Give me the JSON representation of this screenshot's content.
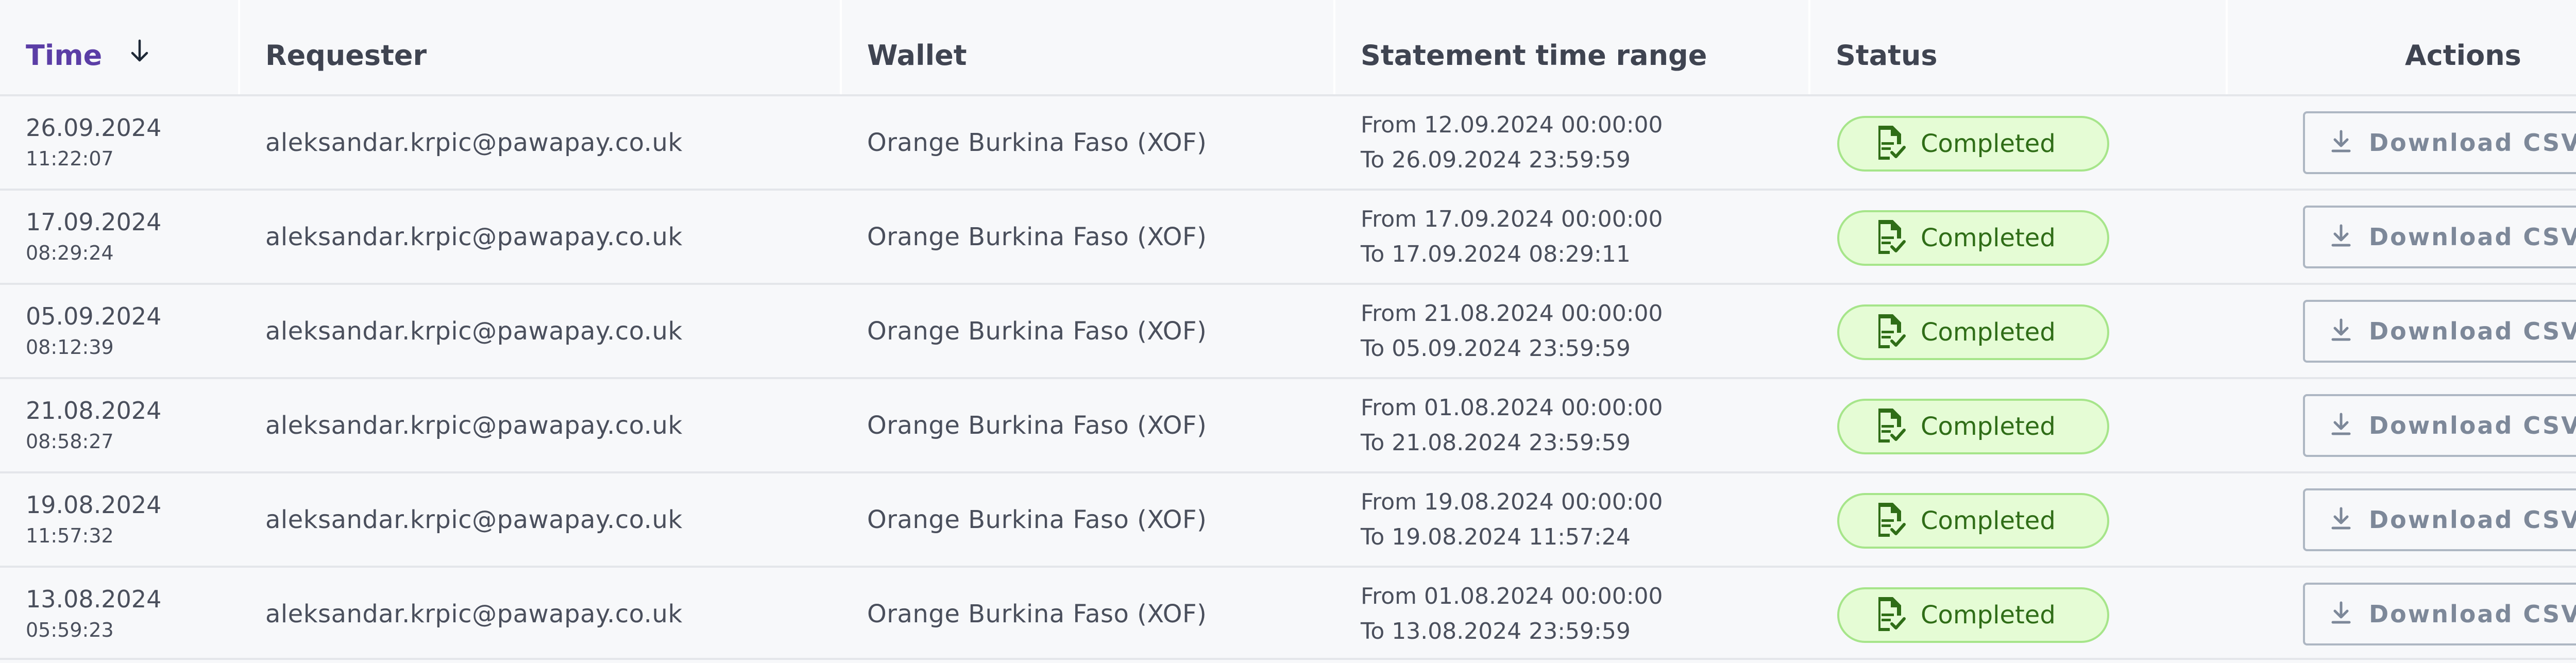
{
  "table": {
    "columns": {
      "time": "Time",
      "requester": "Requester",
      "wallet": "Wallet",
      "range": "Statement time range",
      "status": "Status",
      "actions": "Actions"
    },
    "sort": {
      "column": "time",
      "direction": "descending",
      "icon": "arrow-down-icon"
    },
    "rows": [
      {
        "date": "26.09.2024",
        "time": "11:22:07",
        "requester": "aleksandar.krpic@pawapay.co.uk",
        "wallet": "Orange Burkina Faso (XOF)",
        "range_from": "From 12.09.2024 00:00:00",
        "range_to": "To 26.09.2024 23:59:59",
        "status": "Completed",
        "action": "Download CSV"
      },
      {
        "date": "17.09.2024",
        "time": "08:29:24",
        "requester": "aleksandar.krpic@pawapay.co.uk",
        "wallet": "Orange Burkina Faso (XOF)",
        "range_from": "From 17.09.2024 00:00:00",
        "range_to": "To 17.09.2024 08:29:11",
        "status": "Completed",
        "action": "Download CSV"
      },
      {
        "date": "05.09.2024",
        "time": "08:12:39",
        "requester": "aleksandar.krpic@pawapay.co.uk",
        "wallet": "Orange Burkina Faso (XOF)",
        "range_from": "From 21.08.2024 00:00:00",
        "range_to": "To 05.09.2024 23:59:59",
        "status": "Completed",
        "action": "Download CSV"
      },
      {
        "date": "21.08.2024",
        "time": "08:58:27",
        "requester": "aleksandar.krpic@pawapay.co.uk",
        "wallet": "Orange Burkina Faso (XOF)",
        "range_from": "From 01.08.2024 00:00:00",
        "range_to": "To 21.08.2024 23:59:59",
        "status": "Completed",
        "action": "Download CSV"
      },
      {
        "date": "19.08.2024",
        "time": "11:57:32",
        "requester": "aleksandar.krpic@pawapay.co.uk",
        "wallet": "Orange Burkina Faso (XOF)",
        "range_from": "From 19.08.2024 00:00:00",
        "range_to": "To 19.08.2024 11:57:24",
        "status": "Completed",
        "action": "Download CSV"
      },
      {
        "date": "13.08.2024",
        "time": "05:59:23",
        "requester": "aleksandar.krpic@pawapay.co.uk",
        "wallet": "Orange Burkina Faso (XOF)",
        "range_from": "From 01.08.2024 00:00:00",
        "range_to": "To 13.08.2024 23:59:59",
        "status": "Completed",
        "action": "Download CSV"
      }
    ]
  },
  "icons": {
    "status": "document-check-icon",
    "action": "download-icon"
  },
  "colors": {
    "sorted_header": "#5b3ea6",
    "badge_bg": "#e5fcd5",
    "badge_border": "#a6e58a",
    "badge_text": "#2f6d17",
    "button_border": "#aeb7c3",
    "button_text": "#7d8899"
  }
}
